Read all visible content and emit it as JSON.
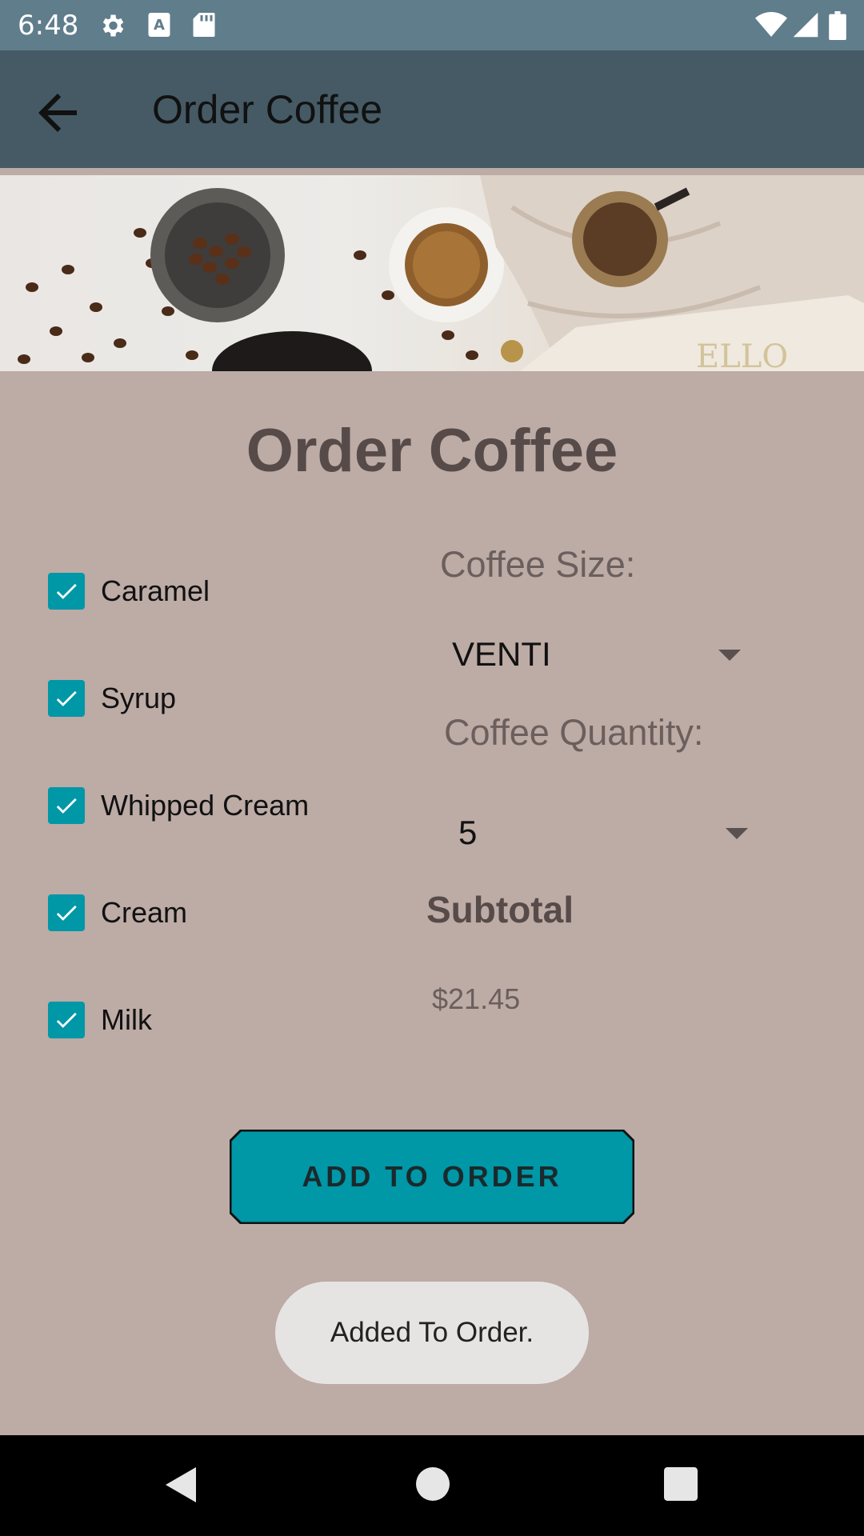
{
  "status_bar": {
    "time": "6:48",
    "icons": [
      "gear-icon",
      "a-text-icon",
      "sd-card-icon",
      "wifi-icon",
      "signal-icon",
      "battery-icon"
    ]
  },
  "app_bar": {
    "back_icon": "arrow-back-icon",
    "title": "Order Coffee"
  },
  "hero": {
    "description_icon": "coffee-banner-image"
  },
  "page": {
    "heading": "Order Coffee"
  },
  "addons": [
    {
      "label": "Caramel",
      "checked": true
    },
    {
      "label": "Syrup",
      "checked": true
    },
    {
      "label": "Whipped Cream",
      "checked": true
    },
    {
      "label": "Cream",
      "checked": true
    },
    {
      "label": "Milk",
      "checked": true
    }
  ],
  "size": {
    "label": "Coffee Size:",
    "value": "VENTI"
  },
  "quantity": {
    "label": "Coffee Quantity:",
    "value": "5"
  },
  "subtotal": {
    "label": "Subtotal",
    "value": "$21.45"
  },
  "add_button": {
    "label": "ADD TO ORDER"
  },
  "toast": {
    "message": "Added To Order."
  },
  "nav_bar": {
    "icons": [
      "back-triangle-icon",
      "home-circle-icon",
      "recents-square-icon"
    ]
  },
  "colors": {
    "status_bar": "#607d8b",
    "app_bar": "#455a64",
    "background": "#bdaba6",
    "accent": "#0097a7"
  }
}
